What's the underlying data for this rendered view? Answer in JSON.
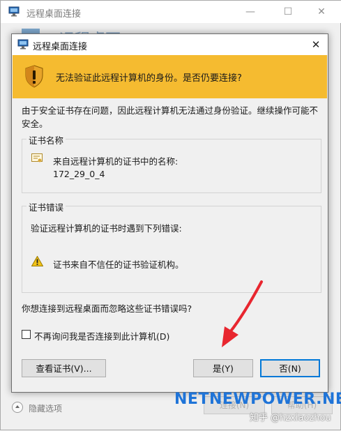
{
  "background_window": {
    "title": "远程桌面连接",
    "heading": "远程桌面",
    "options_label": "隐藏选项",
    "connect_label": "连接(N)",
    "help_label": "帮助(H)"
  },
  "dialog": {
    "title": "远程桌面连接",
    "warning": "无法验证此远程计算机的身份。是否仍要连接?",
    "body": "由于安全证书存在问题，因此远程计算机无法通过身份验证。继续操作可能不安全。",
    "cert_name_group": {
      "label": "证书名称",
      "name_label": "来自远程计算机的证书中的名称:",
      "name_value": "172_29_0_4"
    },
    "cert_errors_group": {
      "label": "证书错误",
      "description": "验证远程计算机的证书时遇到下列错误:",
      "error": "证书来自不信任的证书验证机构。"
    },
    "question": "你想连接到远程桌面而忽略这些证书错误吗?",
    "dont_ask_label": "不再询问我是否连接到此计算机(D)",
    "dont_ask_checked": false,
    "buttons": {
      "view_cert": "查看证书(V)...",
      "yes": "是(Y)",
      "no": "否(N)"
    }
  },
  "overlay": {
    "watermark": "NETNEWPOWER.NET",
    "credit": "知乎 @hzxiaozhou"
  },
  "colors": {
    "warning_banner": "#f5bb30",
    "focus_border": "#0078d7",
    "arrow": "#e8262f",
    "watermark": "#1f74d8"
  }
}
